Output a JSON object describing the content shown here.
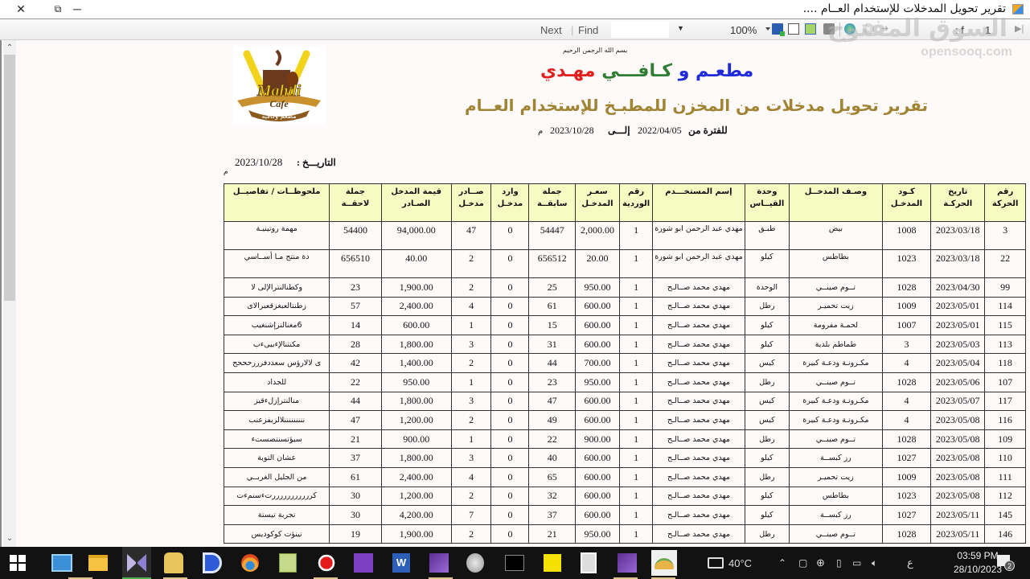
{
  "window": {
    "title": "تقرير تحويل المدخلات للإستخدام العــام ....",
    "close_icon": "close-icon",
    "restore_icon": "restore-icon",
    "minimize_icon": "minimize-icon"
  },
  "toolbar": {
    "next_label": "Next",
    "find_label": "Find",
    "search_value": "",
    "zoom_value": "100%",
    "page_current": "1",
    "page_sep": ": f",
    "icons": [
      "dropdown-arrow-icon",
      "export-save-icon",
      "page-layout-icon",
      "page-setup-icon",
      "print-icon",
      "refresh-icon",
      "stop-icon",
      "back-icon",
      "last-page-icon"
    ]
  },
  "watermark": {
    "arabic": "السوق المفتوح",
    "latin": "opensooq.com"
  },
  "report": {
    "bismillah": "بسم الله الرحمن الرحيم",
    "brand": {
      "part1": "مطعـم و",
      "part2": "كـافـــي",
      "part3": "مهـدي"
    },
    "brand_colors": {
      "part1": "#1f2bd8",
      "part2": "#2e7d32",
      "part3": "#e0201f"
    },
    "title": "تقرير تحويل مدخلات من المخزن للمطبـخ للإستخدام العــام",
    "title_color": "#a08433",
    "logo": {
      "text1": "Mahdi",
      "text2": "Cafe",
      "text3": "مطعم وكافيه"
    },
    "period": {
      "label": "للفترة من",
      "from": "2022/04/05",
      "to_label": "إلـــى",
      "to": "2023/10/28",
      "suffix": "م"
    },
    "date": {
      "label": "التاريـــخ :",
      "value": "2023/10/28",
      "suffix": "م"
    },
    "header_bg": "#f6fbc3",
    "columns": [
      "رقم الحركة",
      "تاريخ الحركـة",
      "كـود المدخـل",
      "وصـف المدخــل",
      "وحدة القيــاس",
      "إسم المستخـــدم",
      "رقم الوردية",
      "سعـر المدخـل",
      "جملة سابقــة",
      "وارد مدخـل",
      "صــادر مدخـل",
      "قيمة المدخل الصـادر",
      "جملة لاحقــة",
      "ملحوظــات / تفاصيــل"
    ],
    "rows": [
      [
        "3",
        "2023/03/18",
        "1008",
        "بيض",
        "طبـق",
        "مهدي عبد الرحمن ابو شورة",
        "1",
        "2,000.00",
        "54447",
        "0",
        "47",
        "94,000.00",
        "54400",
        "مهمة روتينيـة"
      ],
      [
        "22",
        "2023/03/18",
        "1023",
        "بطاطس",
        "كيلو",
        "مهدي عبد الرحمن ابو شورة",
        "1",
        "20.00",
        "656512",
        "0",
        "2",
        "40.00",
        "656510",
        "دة منتج مـا أســاسي"
      ],
      [
        "99",
        "2023/04/30",
        "1028",
        "تــوم صينــي",
        "الوحدة",
        "مهدي محمد صــالـح",
        "1",
        "950.00",
        "25",
        "0",
        "2",
        "1,900.00",
        "23",
        "وكطنالنترالإلى لا"
      ],
      [
        "114",
        "2023/05/01",
        "1009",
        "زيت تحميـر",
        "رطل",
        "مهدي محمد صــالـح",
        "1",
        "600.00",
        "61",
        "0",
        "4",
        "2,400.00",
        "57",
        "زطنتالعبغزقعبرالاى"
      ],
      [
        "115",
        "2023/05/01",
        "1007",
        "لحمـة مفرومة",
        "كيلو",
        "مهدي محمد صــالـح",
        "1",
        "600.00",
        "15",
        "0",
        "1",
        "600.00",
        "14",
        "6مغنالنزإشنغيب"
      ],
      [
        "113",
        "2023/05/03",
        "3",
        "طماطم بلدية",
        "كيلو",
        "مهدي محمد صــالـح",
        "1",
        "600.00",
        "31",
        "0",
        "3",
        "1,800.00",
        "28",
        "مكنتنالإءبيىءب"
      ],
      [
        "118",
        "2023/05/04",
        "4",
        "مكـرونـة ودعـة كبيرة",
        "كيس",
        "مهدي محمد صــالـح",
        "1",
        "700.00",
        "44",
        "0",
        "2",
        "1,400.00",
        "42",
        "ى لالارؤس سعددفرررحححح"
      ],
      [
        "107",
        "2023/05/06",
        "1028",
        "تــوم صينــي",
        "رطل",
        "مهدي محمد صــالـح",
        "1",
        "950.00",
        "23",
        "0",
        "1",
        "950.00",
        "22",
        "للجداد"
      ],
      [
        "117",
        "2023/05/07",
        "4",
        "مكـرونـة ودعـة كبيرة",
        "كيس",
        "مهدي محمد صــالـح",
        "1",
        "600.00",
        "47",
        "0",
        "3",
        "1,800.00",
        "44",
        "منالنترإزلءقيز"
      ],
      [
        "116",
        "2023/05/08",
        "4",
        "مكـرونـة ودعـة كبيرة",
        "كيس",
        "مهدي محمد صــالـح",
        "1",
        "600.00",
        "49",
        "0",
        "2",
        "1,200.00",
        "47",
        "نننننننننلالزبفزعنب"
      ],
      [
        "109",
        "2023/05/08",
        "1028",
        "تــوم صينــي",
        "رطل",
        "مهدي محمد صــالـح",
        "1",
        "900.00",
        "22",
        "0",
        "1",
        "900.00",
        "21",
        "سيؤتسنتصستء"
      ],
      [
        "110",
        "2023/05/08",
        "1027",
        "رز كبســة",
        "كيلو",
        "مهدي محمد صــالـح",
        "1",
        "600.00",
        "40",
        "0",
        "3",
        "1,800.00",
        "37",
        "عشان التوبة"
      ],
      [
        "111",
        "2023/05/08",
        "1009",
        "زيت تحميـر",
        "رطل",
        "مهدي محمد صــالـح",
        "1",
        "600.00",
        "65",
        "0",
        "4",
        "2,400.00",
        "61",
        "من الجليل الغربــي"
      ],
      [
        "112",
        "2023/05/08",
        "1023",
        "بطاطس",
        "كيلو",
        "مهدي محمد صــالـح",
        "1",
        "600.00",
        "32",
        "0",
        "2",
        "1,200.00",
        "30",
        "كرررررررررررتءسنمءت"
      ],
      [
        "145",
        "2023/05/11",
        "1027",
        "رز كبســة",
        "كيلو",
        "مهدي محمد صــالـح",
        "1",
        "600.00",
        "37",
        "0",
        "7",
        "4,200.00",
        "30",
        "تجربة تيستة"
      ],
      [
        "146",
        "2023/05/11",
        "1028",
        "تــوم صينــي",
        "رطل",
        "مهدي محمد صــالـح",
        "1",
        "950.00",
        "21",
        "0",
        "2",
        "1,900.00",
        "19",
        "تينؤت كوكوديس"
      ]
    ]
  },
  "taskbar": {
    "apps": [
      "start-icon",
      "control-panel-icon",
      "file-explorer-icon",
      "kmplayer-icon",
      "db-tools-icon",
      "deskpins-icon",
      "browser-icon",
      "notepad-plus-icon",
      "recorder-icon",
      "visual-studio-icon",
      "word-icon",
      "visual-studio-2-icon",
      "speaker-app-icon",
      "terminal-icon",
      "sticky-notes-icon",
      "calculator-icon",
      "visual-studio-3-icon",
      "taco-app-icon"
    ],
    "weather": "40°C",
    "language": "ع",
    "time": "03:59 PM",
    "date": "28/10/2023",
    "notifications": "2"
  }
}
